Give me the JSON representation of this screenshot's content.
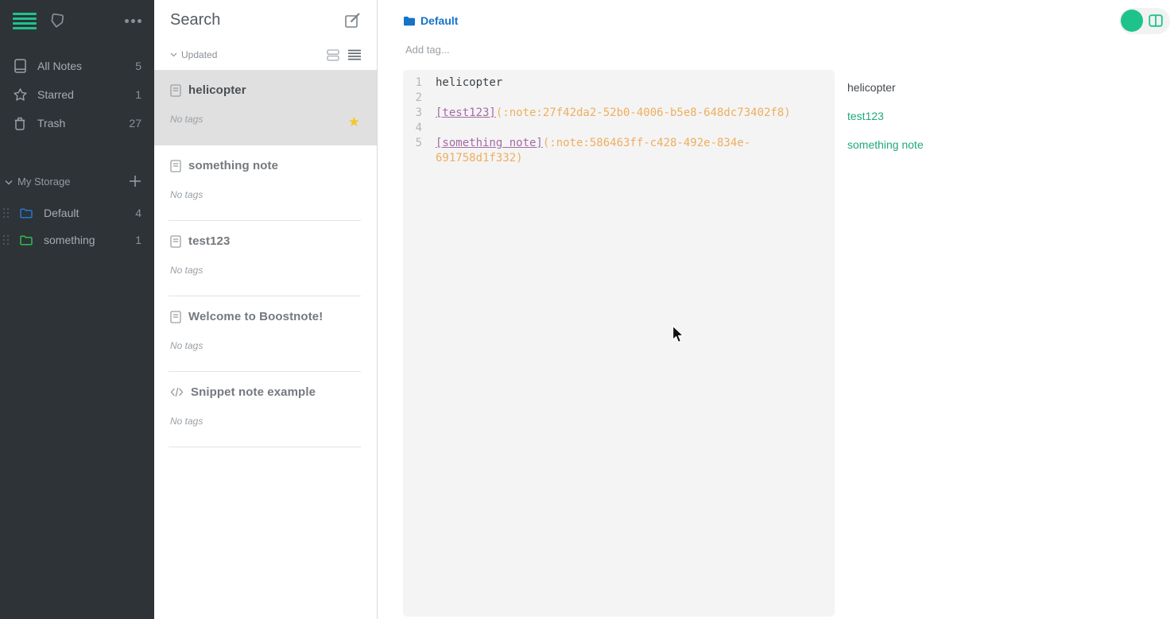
{
  "colors": {
    "accent": "#1ec38b",
    "star": "#f6c62d",
    "folder_blue": "#2577d0",
    "folder_green": "#2bbf4d",
    "folder_blue_strong": "#1573c8",
    "link_green": "#1ea97c",
    "code_purple": "#a46ca4",
    "code_orange": "#eeae5f"
  },
  "sidebar": {
    "top_icons": [
      "menu-icon",
      "tag-icon",
      "more-icon"
    ],
    "nav": [
      {
        "icon": "notes-icon",
        "label": "All Notes",
        "count": "5"
      },
      {
        "icon": "star-outline-icon",
        "label": "Starred",
        "count": "1"
      },
      {
        "icon": "trash-icon",
        "label": "Trash",
        "count": "27"
      }
    ],
    "storage": {
      "label": "My Storage",
      "chevron_icon": "chevron-down-icon",
      "add_icon": "plus-icon",
      "folders": [
        {
          "icon": "folder-icon",
          "color_key": "folder_blue",
          "label": "Default",
          "count": "4"
        },
        {
          "icon": "folder-icon",
          "color_key": "folder_green",
          "label": "something",
          "count": "1"
        }
      ]
    }
  },
  "notelist": {
    "title": "Search",
    "compose_icon": "compose-icon",
    "sort_label": "Updated",
    "view_icons": [
      "card-view-icon",
      "list-view-icon"
    ],
    "notes": [
      {
        "icon": "document-icon",
        "title": "helicopter",
        "tags": "No tags",
        "selected": true,
        "starred": true
      },
      {
        "icon": "document-icon",
        "title": "something note",
        "tags": "No tags",
        "selected": false,
        "starred": false
      },
      {
        "icon": "document-icon",
        "title": "test123",
        "tags": "No tags",
        "selected": false,
        "starred": false
      },
      {
        "icon": "document-icon",
        "title": "Welcome to Boostnote!",
        "tags": "No tags",
        "selected": false,
        "starred": false
      },
      {
        "icon": "code-icon",
        "title": "Snippet note example",
        "tags": "No tags",
        "selected": false,
        "starred": false
      }
    ]
  },
  "editor": {
    "breadcrumb": {
      "icon": "folder-filled-icon",
      "label": "Default"
    },
    "add_tag_label": "Add tag...",
    "toggle": {
      "icons": [
        "status-circle-icon",
        "split-view-icon"
      ]
    },
    "lines": [
      {
        "num": "1",
        "segments": [
          {
            "type": "plain",
            "text": "helicopter"
          }
        ]
      },
      {
        "num": "2",
        "segments": []
      },
      {
        "num": "3",
        "segments": [
          {
            "type": "link",
            "text": "[test123]"
          },
          {
            "type": "url",
            "text": "(:note:27f42da2-52b0-4006-b5e8-648dc73402f8)"
          }
        ]
      },
      {
        "num": "4",
        "segments": []
      },
      {
        "num": "5",
        "segments": [
          {
            "type": "link",
            "text": "[something note]"
          },
          {
            "type": "url",
            "text": "(:note:586463ff-c428-492e-834e-691758d1f332)"
          }
        ]
      }
    ]
  },
  "preview": {
    "paragraphs": [
      {
        "type": "plain",
        "text": "helicopter"
      },
      {
        "type": "link",
        "text": "test123"
      },
      {
        "type": "link",
        "text": "something note"
      }
    ]
  }
}
